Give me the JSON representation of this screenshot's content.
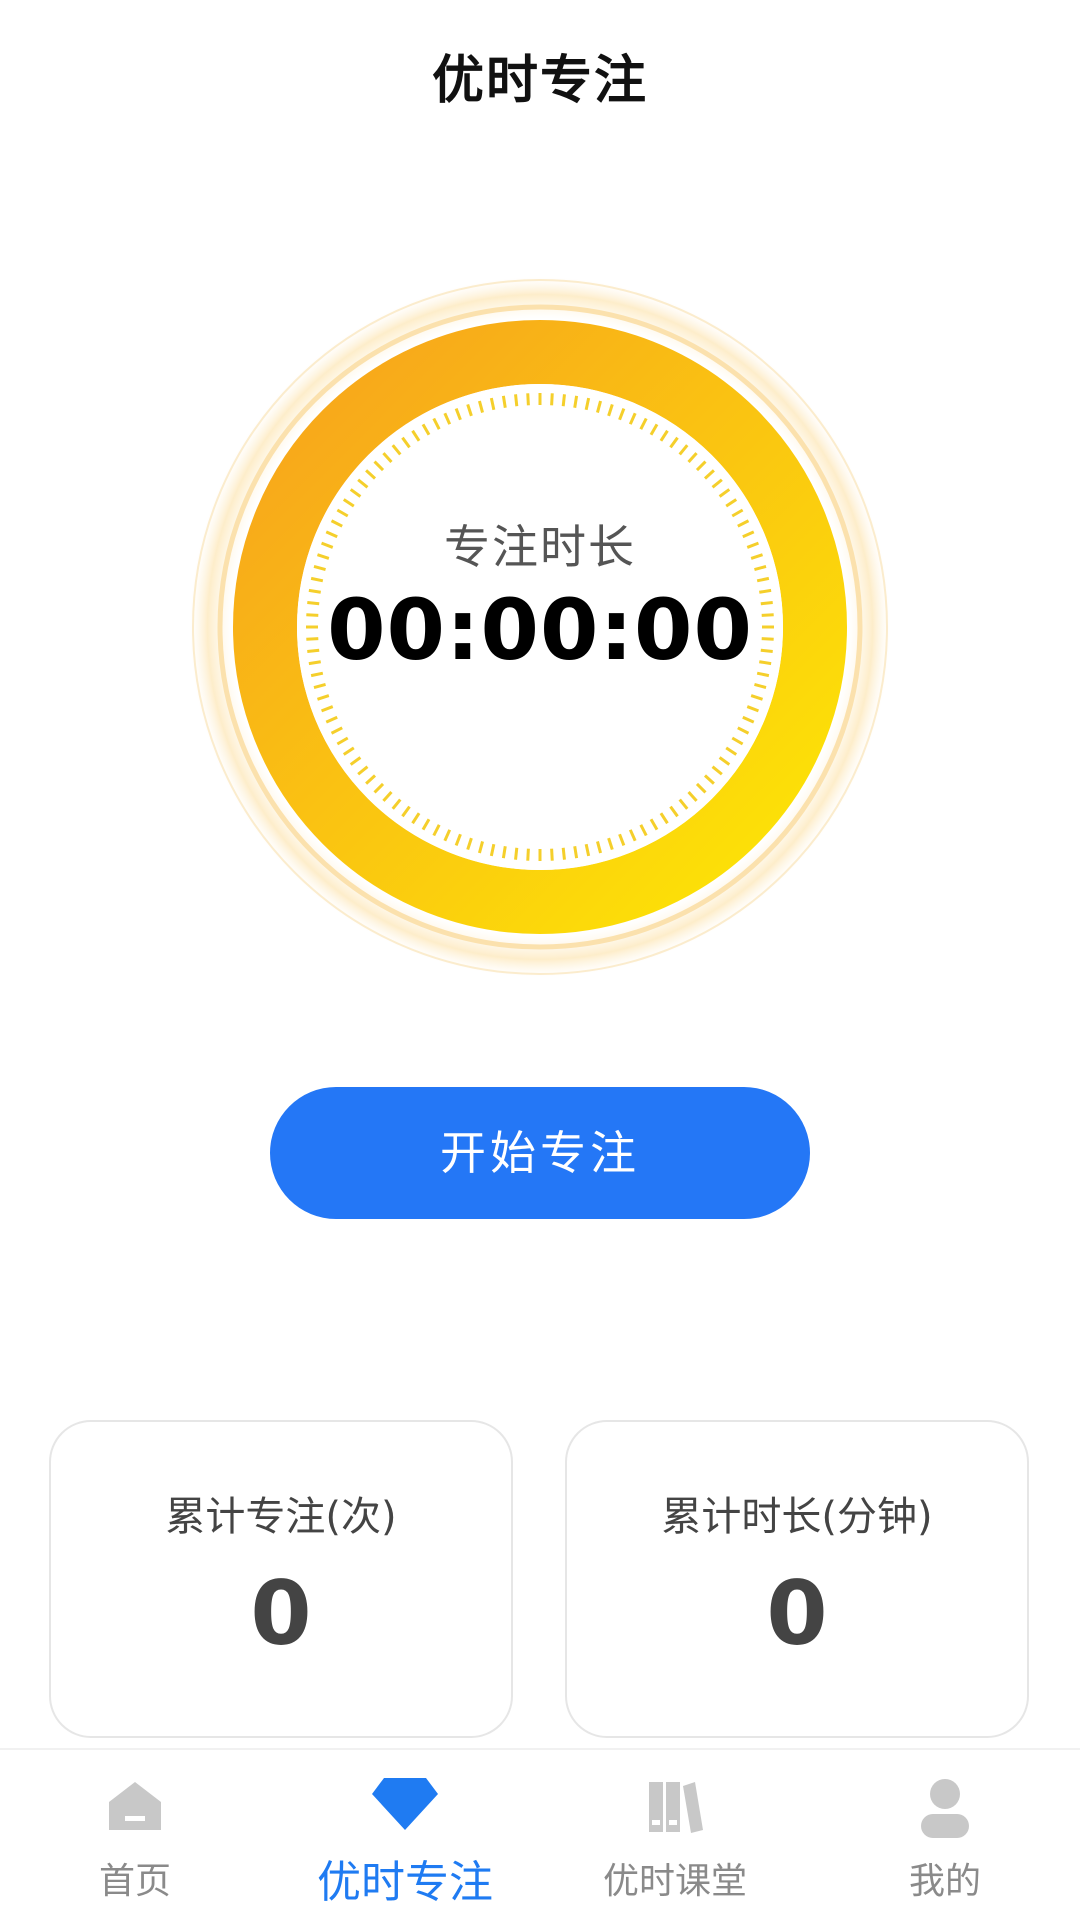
{
  "header": {
    "title": "优时专注"
  },
  "timer": {
    "label": "专注时长",
    "value": "00:00:00",
    "colors": {
      "ring_start": "#f8a61c",
      "ring_end": "#fde705",
      "tick": "#f5cf2b",
      "halo": "#fbe7c3"
    }
  },
  "actions": {
    "start_label": "开始专注",
    "accent": "#2477f6"
  },
  "stats": [
    {
      "label": "累计专注(次)",
      "value": "0"
    },
    {
      "label": "累计时长(分钟)",
      "value": "0"
    }
  ],
  "tabbar": {
    "active_color": "#1f7bf2",
    "inactive_color": "#c8c8c8",
    "items": [
      {
        "label": "首页",
        "icon": "home-icon",
        "active": false
      },
      {
        "label": "优时专注",
        "icon": "diamond-icon",
        "active": true
      },
      {
        "label": "优时课堂",
        "icon": "books-icon",
        "active": false
      },
      {
        "label": "我的",
        "icon": "user-icon",
        "active": false
      }
    ]
  }
}
